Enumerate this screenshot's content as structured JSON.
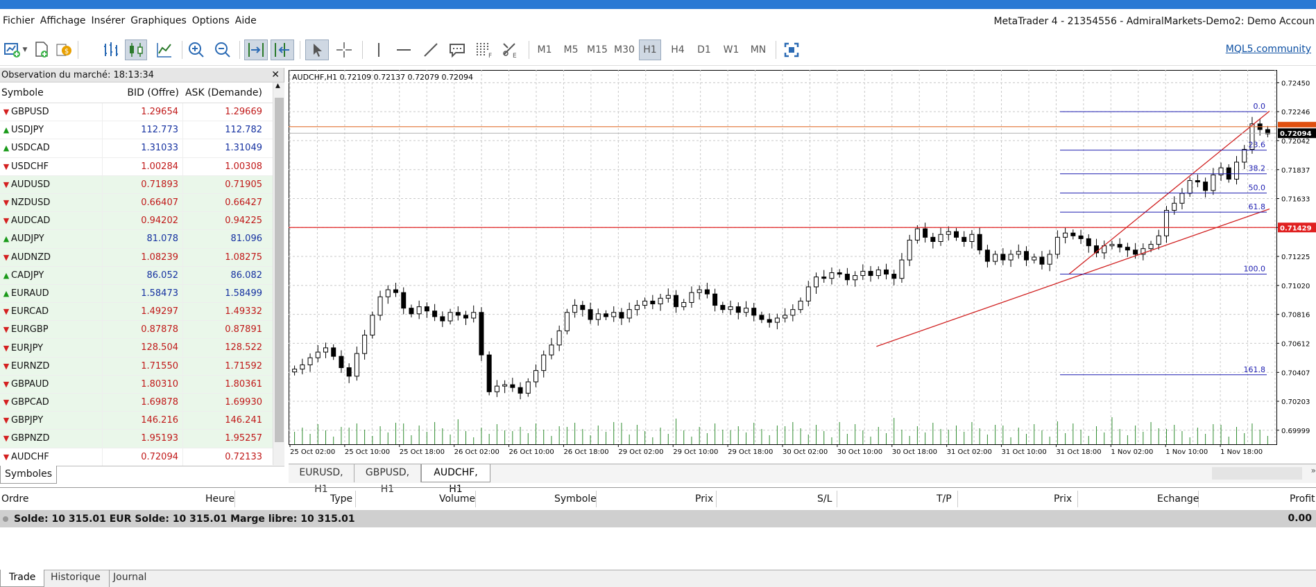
{
  "menu": {
    "items": [
      "Fichier",
      "Affichage",
      "Insérer",
      "Graphiques",
      "Options",
      "Aide"
    ],
    "window_title": "MetaTrader 4 - 21354556 - AdmiralMarkets-Demo2: Demo Accoun"
  },
  "toolbar": {
    "timeframes": [
      "M1",
      "M5",
      "M15",
      "M30",
      "H1",
      "H4",
      "D1",
      "W1",
      "MN"
    ],
    "active_timeframe": "H1",
    "mql_link": "MQL5.community"
  },
  "market_watch": {
    "title": "Observation du marché: 18:13:34",
    "col_symbol": "Symbole",
    "col_bid": "BID (Offre)",
    "col_ask": "ASK (Demande)",
    "tab_label": "Symboles",
    "rows": [
      {
        "symbol": "GBPUSD",
        "bid": "1.29654",
        "ask": "1.29669",
        "dir": "down",
        "color": "red",
        "bg": "white"
      },
      {
        "symbol": "USDJPY",
        "bid": "112.773",
        "ask": "112.782",
        "dir": "up",
        "color": "blue",
        "bg": "white"
      },
      {
        "symbol": "USDCAD",
        "bid": "1.31033",
        "ask": "1.31049",
        "dir": "up",
        "color": "blue",
        "bg": "white"
      },
      {
        "symbol": "USDCHF",
        "bid": "1.00284",
        "ask": "1.00308",
        "dir": "down",
        "color": "red",
        "bg": "white"
      },
      {
        "symbol": "AUDUSD",
        "bid": "0.71893",
        "ask": "0.71905",
        "dir": "down",
        "color": "red",
        "bg": "green"
      },
      {
        "symbol": "NZDUSD",
        "bid": "0.66407",
        "ask": "0.66427",
        "dir": "down",
        "color": "red",
        "bg": "green"
      },
      {
        "symbol": "AUDCAD",
        "bid": "0.94202",
        "ask": "0.94225",
        "dir": "down",
        "color": "red",
        "bg": "green"
      },
      {
        "symbol": "AUDJPY",
        "bid": "81.078",
        "ask": "81.096",
        "dir": "up",
        "color": "blue",
        "bg": "green"
      },
      {
        "symbol": "AUDNZD",
        "bid": "1.08239",
        "ask": "1.08275",
        "dir": "down",
        "color": "red",
        "bg": "green"
      },
      {
        "symbol": "CADJPY",
        "bid": "86.052",
        "ask": "86.082",
        "dir": "up",
        "color": "blue",
        "bg": "green"
      },
      {
        "symbol": "EURAUD",
        "bid": "1.58473",
        "ask": "1.58499",
        "dir": "up",
        "color": "blue",
        "bg": "green"
      },
      {
        "symbol": "EURCAD",
        "bid": "1.49297",
        "ask": "1.49332",
        "dir": "down",
        "color": "red",
        "bg": "green"
      },
      {
        "symbol": "EURGBP",
        "bid": "0.87878",
        "ask": "0.87891",
        "dir": "down",
        "color": "red",
        "bg": "green"
      },
      {
        "symbol": "EURJPY",
        "bid": "128.504",
        "ask": "128.522",
        "dir": "down",
        "color": "red",
        "bg": "green"
      },
      {
        "symbol": "EURNZD",
        "bid": "1.71550",
        "ask": "1.71592",
        "dir": "down",
        "color": "red",
        "bg": "green"
      },
      {
        "symbol": "GBPAUD",
        "bid": "1.80310",
        "ask": "1.80361",
        "dir": "down",
        "color": "red",
        "bg": "green"
      },
      {
        "symbol": "GBPCAD",
        "bid": "1.69878",
        "ask": "1.69930",
        "dir": "down",
        "color": "red",
        "bg": "green"
      },
      {
        "symbol": "GBPJPY",
        "bid": "146.216",
        "ask": "146.241",
        "dir": "down",
        "color": "red",
        "bg": "green"
      },
      {
        "symbol": "GBPNZD",
        "bid": "1.95193",
        "ask": "1.95257",
        "dir": "down",
        "color": "red",
        "bg": "green"
      },
      {
        "symbol": "AUDCHF",
        "bid": "0.72094",
        "ask": "0.72133",
        "dir": "down",
        "color": "red",
        "bg": "white"
      }
    ]
  },
  "chart": {
    "header": "AUDCHF,H1  0.72109 0.72137 0.72079 0.72094",
    "tabs": [
      "EURUSD, H1",
      "GBPUSD, H1",
      "AUDCHF, H1"
    ],
    "active_tab": "AUDCHF, H1"
  },
  "chart_data": {
    "type": "candlestick",
    "symbol": "AUDCHF",
    "timeframe": "H1",
    "price_ticks": [
      "0.72450",
      "0.72246",
      "0.72042",
      "0.71837",
      "0.71633",
      "0.71429",
      "0.71225",
      "0.71020",
      "0.70816",
      "0.70612",
      "0.70407",
      "0.70203",
      "0.69999"
    ],
    "ylim": [
      0.69999,
      0.7245
    ],
    "time_ticks": [
      "25 Oct 02:00",
      "25 Oct 10:00",
      "25 Oct 18:00",
      "26 Oct 02:00",
      "26 Oct 10:00",
      "26 Oct 18:00",
      "29 Oct 02:00",
      "29 Oct 10:00",
      "29 Oct 18:00",
      "30 Oct 02:00",
      "30 Oct 10:00",
      "30 Oct 18:00",
      "31 Oct 02:00",
      "31 Oct 10:00",
      "31 Oct 18:00",
      "1 Nov 02:00",
      "1 Nov 10:00",
      "1 Nov 18:00"
    ],
    "current_price": "0.72094",
    "hline_price": "0.71429",
    "ask_line": 0.7214,
    "fib_levels": [
      {
        "label": "0.0",
        "price": 0.72246
      },
      {
        "label": "23.6",
        "price": 0.71975
      },
      {
        "label": "38.2",
        "price": 0.71808
      },
      {
        "label": "50.0",
        "price": 0.71672
      },
      {
        "label": "61.8",
        "price": 0.71537
      },
      {
        "label": "100.0",
        "price": 0.711
      },
      {
        "label": "161.8",
        "price": 0.7039
      }
    ],
    "trendlines": [
      {
        "from": [
          0.6,
          0.7059
        ],
        "to": [
          1.0,
          0.7156
        ]
      },
      {
        "from": [
          0.79,
          0.711
        ],
        "to": [
          1.0,
          0.7225
        ]
      }
    ],
    "grid": true,
    "closes": [
      0.7043,
      0.7046,
      0.7051,
      0.7055,
      0.7058,
      0.7052,
      0.7044,
      0.7038,
      0.7054,
      0.7067,
      0.7081,
      0.7094,
      0.7099,
      0.7097,
      0.7086,
      0.7082,
      0.7087,
      0.7084,
      0.708,
      0.7077,
      0.7083,
      0.7081,
      0.7079,
      0.7083,
      0.7053,
      0.7027,
      0.7031,
      0.7032,
      0.703,
      0.7026,
      0.7034,
      0.7042,
      0.7053,
      0.706,
      0.707,
      0.7083,
      0.7088,
      0.7085,
      0.7078,
      0.7082,
      0.708,
      0.7083,
      0.7079,
      0.7085,
      0.7088,
      0.7091,
      0.7089,
      0.7093,
      0.7095,
      0.7087,
      0.709,
      0.7097,
      0.7099,
      0.7096,
      0.7088,
      0.7085,
      0.7087,
      0.7083,
      0.7086,
      0.7081,
      0.7078,
      0.7076,
      0.7079,
      0.7081,
      0.7085,
      0.7091,
      0.7101,
      0.7108,
      0.7107,
      0.7111,
      0.711,
      0.7106,
      0.7109,
      0.7112,
      0.7109,
      0.7113,
      0.711,
      0.7107,
      0.712,
      0.7134,
      0.7142,
      0.7136,
      0.7133,
      0.7138,
      0.714,
      0.7136,
      0.7133,
      0.7138,
      0.7127,
      0.7119,
      0.7124,
      0.712,
      0.7124,
      0.7126,
      0.712,
      0.7122,
      0.7117,
      0.7124,
      0.7136,
      0.7139,
      0.7137,
      0.7135,
      0.713,
      0.7125,
      0.713,
      0.7131,
      0.7129,
      0.7127,
      0.7124,
      0.7128,
      0.7131,
      0.7137,
      0.7155,
      0.716,
      0.7167,
      0.7176,
      0.7175,
      0.7169,
      0.718,
      0.7185,
      0.7177,
      0.7189,
      0.7198,
      0.7216,
      0.7212,
      0.7209
    ]
  },
  "terminal": {
    "columns": [
      "Ordre",
      "Heure",
      "Type",
      "Volume",
      "Symbole",
      "Prix",
      "S/L",
      "T/P",
      "Prix",
      "Echange",
      "Profit"
    ],
    "summary": "Solde: 10 315.01 EUR  Solde: 10 315.01  Marge libre: 10 315.01",
    "profit_total": "0.00",
    "tabs": [
      "Trade",
      "Historique",
      "Journal"
    ],
    "active_tab": "Trade"
  },
  "colors": {
    "title_bar": "#2a79d4",
    "fib": "#1b1bb0",
    "trendline": "#d02020",
    "hline": "#e02020",
    "price_marker": "#000000",
    "hline_marker": "#e02020"
  }
}
